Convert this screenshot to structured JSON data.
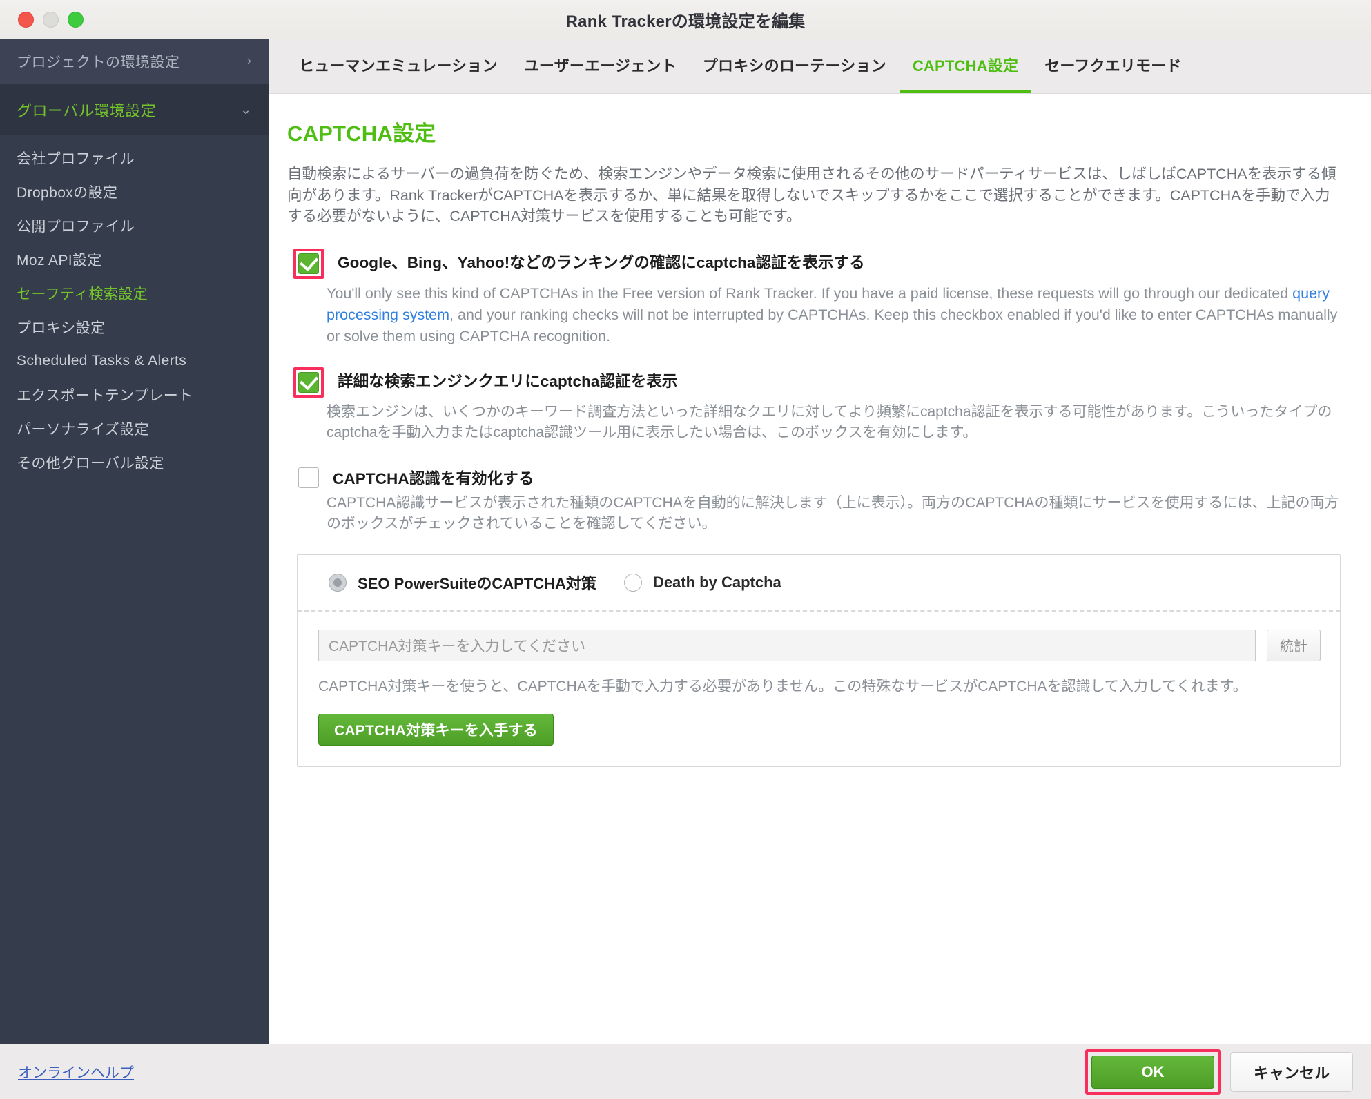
{
  "window": {
    "title": "Rank Trackerの環境設定を編集",
    "traffic_lights": [
      "close",
      "minimize",
      "zoom"
    ]
  },
  "sidebar": {
    "header": {
      "label": "プロジェクトの環境設定",
      "chevron": "›"
    },
    "group": {
      "label": "グローバル環境設定",
      "chevron": "⌄"
    },
    "items": [
      {
        "label": "会社プロファイル",
        "active": false
      },
      {
        "label": "Dropboxの設定",
        "active": false
      },
      {
        "label": "公開プロファイル",
        "active": false
      },
      {
        "label": "Moz API設定",
        "active": false
      },
      {
        "label": "セーフティ検索設定",
        "active": true
      },
      {
        "label": "プロキシ設定",
        "active": false
      },
      {
        "label": "Scheduled Tasks & Alerts",
        "active": false
      },
      {
        "label": "エクスポートテンプレート",
        "active": false
      },
      {
        "label": "パーソナライズ設定",
        "active": false
      },
      {
        "label": "その他グローバル設定",
        "active": false
      }
    ]
  },
  "tabs": [
    {
      "label": "ヒューマンエミュレーション",
      "active": false
    },
    {
      "label": "ユーザーエージェント",
      "active": false
    },
    {
      "label": "プロキシのローテーション",
      "active": false
    },
    {
      "label": "CAPTCHA設定",
      "active": true
    },
    {
      "label": "セーフクエリモード",
      "active": false
    }
  ],
  "pane": {
    "title": "CAPTCHA設定",
    "intro": "自動検索によるサーバーの過負荷を防ぐため、検索エンジンやデータ検索に使用されるその他のサードパーティサービスは、しばしばCAPTCHAを表示する傾向があります。Rank TrackerがCAPTCHAを表示するか、単に結果を取得しないでスキップするかをここで選択することができます。CAPTCHAを手動で入力する必要がないように、CAPTCHA対策サービスを使用することも可能です。",
    "checkbox1": {
      "label": "Google、Bing、Yahoo!などのランキングの確認にcaptcha認証を表示する",
      "checked": true,
      "highlighted": true,
      "desc_part1": "You'll only see this kind of CAPTCHAs in the Free version of Rank Tracker. If you have a paid license, these requests will go through our dedicated ",
      "desc_link": "query processing system",
      "desc_part2": ", and your ranking checks will not be interrupted by CAPTCHAs. Keep this checkbox enabled if you'd like to enter CAPTCHAs manually or solve them using CAPTCHA recognition."
    },
    "checkbox2": {
      "label": "詳細な検索エンジンクエリにcaptcha認証を表示",
      "checked": true,
      "highlighted": true,
      "desc": "検索エンジンは、いくつかのキーワード調査方法といった詳細なクエリに対してより頻繁にcaptcha認証を表示する可能性があります。こういったタイプのcaptchaを手動入力またはcaptcha認識ツール用に表示したい場合は、このボックスを有効にします。"
    },
    "checkbox3": {
      "label": "CAPTCHA認識を有効化する",
      "checked": false,
      "highlighted": false,
      "desc": "CAPTCHA認識サービスが表示された種類のCAPTCHAを自動的に解決します（上に表示）。両方のCAPTCHAの種類にサービスを使用するには、上記の両方のボックスがチェックされていることを確認してください。"
    },
    "service_box": {
      "radios": [
        {
          "label": "SEO PowerSuiteのCAPTCHA対策",
          "selected": true
        },
        {
          "label": "Death by Captcha",
          "selected": false
        }
      ],
      "key_input": {
        "value": "",
        "placeholder": "CAPTCHA対策キーを入力してください"
      },
      "stats_button": "統計",
      "desc": "CAPTCHA対策キーを使うと、CAPTCHAを手動で入力する必要がありません。この特殊なサービスがCAPTCHAを認識して入力してくれます。",
      "get_key_button": "CAPTCHA対策キーを入手する"
    }
  },
  "footer": {
    "help_link": "オンラインヘルプ",
    "ok_button": "OK",
    "ok_highlighted": true,
    "cancel_button": "キャンセル"
  },
  "colors": {
    "accent_green": "#4fbe12",
    "button_green": "#5cb531",
    "sidebar_bg": "#353c4b",
    "highlight_red": "#f82f5c",
    "link_blue": "#2f7fe0"
  }
}
